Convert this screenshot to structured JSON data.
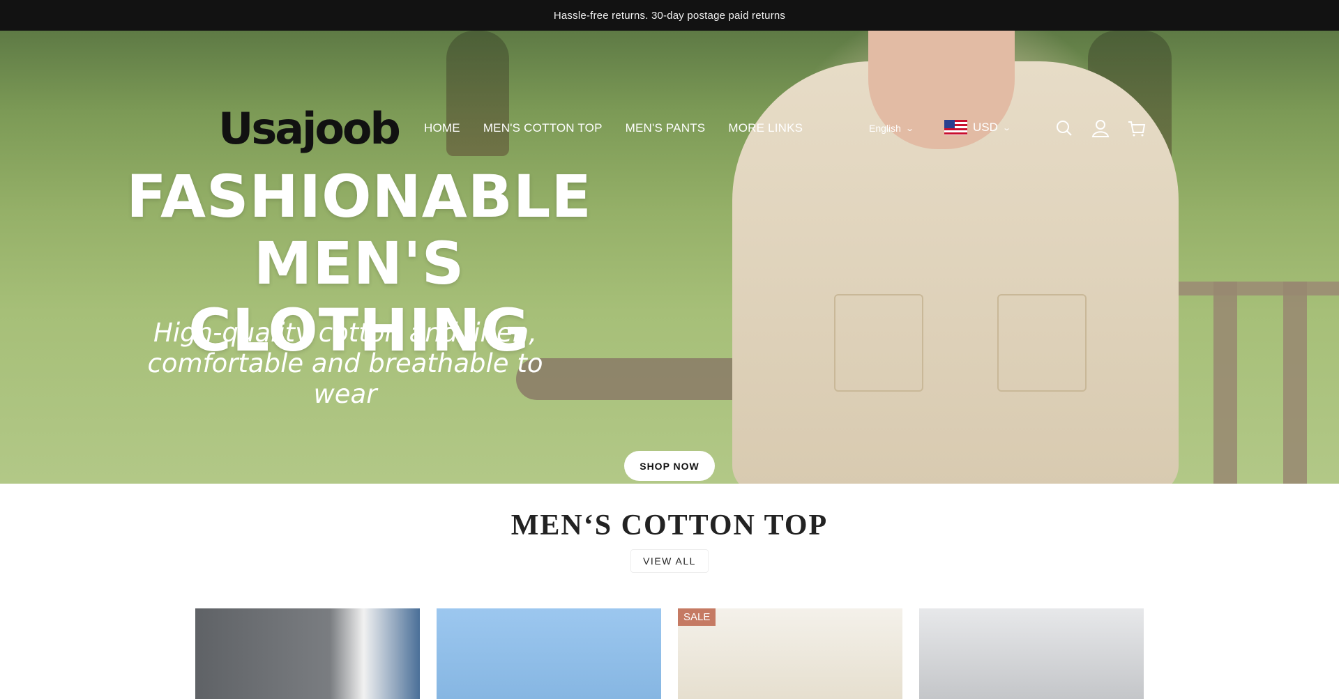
{
  "announcement": "Hassle-free returns. 30-day postage paid returns",
  "header": {
    "logo": "Usajoob",
    "nav": [
      "HOME",
      "MEN'S COTTON TOP",
      "MEN'S PANTS",
      "MORE LINKS"
    ],
    "language": "English",
    "currency": "USD",
    "icons": [
      "search-icon",
      "account-icon",
      "cart-icon"
    ]
  },
  "hero": {
    "title_line1": "FASHIONABLE",
    "title_line2": "MEN'S CLOTHING",
    "subtitle": "High-quality cotton and linen, comfortable and breathable to wear",
    "cta": "SHOP NOW"
  },
  "collection": {
    "title": "MEN‘S COTTON TOP",
    "view_all": "VIEW ALL",
    "products": [
      {
        "badge": "",
        "color": "#6f7276"
      },
      {
        "badge": "",
        "color": "#8fbfe8"
      },
      {
        "badge": "SALE",
        "color": "#e8e1d2"
      },
      {
        "badge": "",
        "color": "#c9cbcd"
      }
    ]
  },
  "colors": {
    "announcement_bg": "#121212",
    "sale_badge": "#c57a63"
  }
}
